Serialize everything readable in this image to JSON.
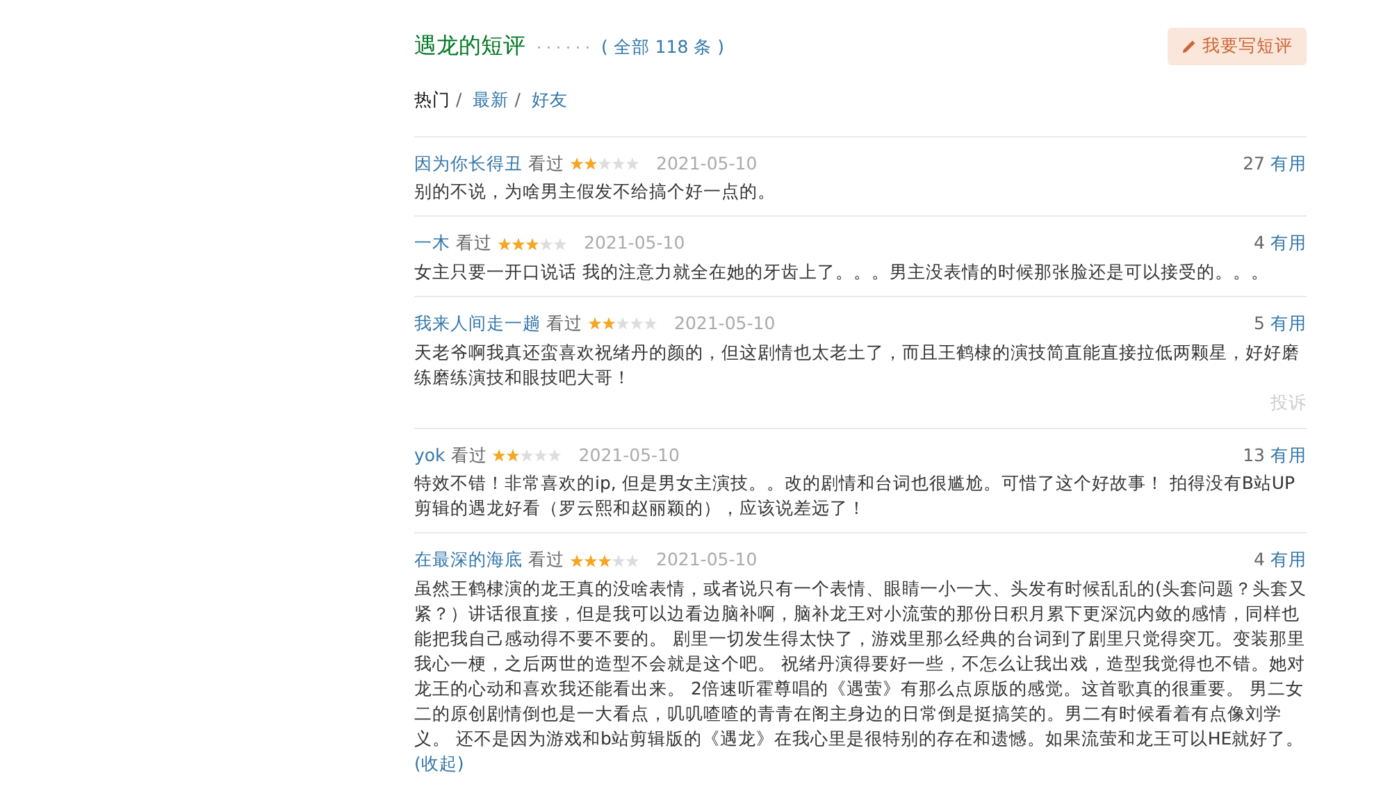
{
  "header": {
    "title": "遇龙的短评",
    "dots": "· · · · · ·",
    "count": "( 全部 118 条 )",
    "write_button": "我要写短评"
  },
  "sort_tabs": [
    {
      "label": "热门",
      "selected": true,
      "sep": "/"
    },
    {
      "label": "最新",
      "selected": false,
      "sep": "/"
    },
    {
      "label": "好友",
      "selected": false
    }
  ],
  "reviews": [
    {
      "user": "因为你长得丑",
      "status": "看过",
      "stars": 2,
      "date": "2021-05-10",
      "votes": "27",
      "useful": "有用",
      "text": "别的不说，为啥男主假发不给搞个好一点的。"
    },
    {
      "user": "一木",
      "status": "看过",
      "stars": 3,
      "date": "2021-05-10",
      "votes": "4",
      "useful": "有用",
      "text": "女主只要一开口说话 我的注意力就全在她的牙齿上了。。。男主没表情的时候那张脸还是可以接受的。。。"
    },
    {
      "user": "我来人间走一趟",
      "status": "看过",
      "stars": 2,
      "date": "2021-05-10",
      "votes": "5",
      "useful": "有用",
      "text": "天老爷啊我真还蛮喜欢祝绪丹的颜的，但这剧情也太老土了，而且王鹤棣的演技简直能直接拉低两颗星，好好磨练磨练演技和眼技吧大哥！",
      "report": "投诉"
    },
    {
      "user": "yok",
      "status": "看过",
      "stars": 2,
      "date": "2021-05-10",
      "votes": "13",
      "useful": "有用",
      "text": "特效不错！非常喜欢的ip, 但是男女主演技。。改的剧情和台词也很尴尬。可惜了这个好故事！ 拍得没有B站UP剪辑的遇龙好看（罗云熙和赵丽颖的），应该说差远了！"
    },
    {
      "user": "在最深的海底",
      "status": "看过",
      "stars": 3,
      "date": "2021-05-10",
      "votes": "4",
      "useful": "有用",
      "text": "虽然王鹤棣演的龙王真的没啥表情，或者说只有一个表情、眼睛一小一大、头发有时候乱乱的(头套问题？头套又紧？）讲话很直接，但是我可以边看边脑补啊，脑补龙王对小流萤的那份日积月累下更深沉内敛的感情，同样也能把我自己感动得不要不要的。 剧里一切发生得太快了，游戏里那么经典的台词到了剧里只觉得突兀。变装那里我心一梗，之后两世的造型不会就是这个吧。 祝绪丹演得要好一些，不怎么让我出戏，造型我觉得也不错。她对龙王的心动和喜欢我还能看出来。 2倍速听霍尊唱的《遇萤》有那么点原版的感觉。这首歌真的很重要。 男二女二的原创剧情倒也是一大看点，叽叽喳喳的青青在阁主身边的日常倒是挺搞笑的。男二有时候看着有点像刘学义。 还不是因为游戏和b站剪辑版的《遇龙》在我心里是很特别的存在和遗憾。如果流萤和龙王可以HE就好了。",
      "collapse": "(收起)"
    }
  ]
}
